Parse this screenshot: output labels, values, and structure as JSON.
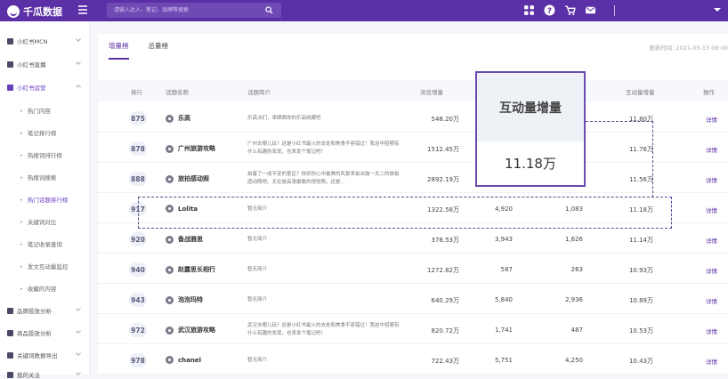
{
  "app": {
    "logo_text": "千瓜数据"
  },
  "search": {
    "placeholder": "请输入达人、笔记、品牌等搜索"
  },
  "sidebar": {
    "sections": [
      {
        "label": "小红书MCN"
      },
      {
        "label": "小红书直播"
      },
      {
        "label": "小红书运营"
      }
    ],
    "subitems": [
      {
        "label": "热门内容"
      },
      {
        "label": "笔记排行榜"
      },
      {
        "label": "热搜词排行榜"
      },
      {
        "label": "热搜词搜索"
      },
      {
        "label": "热门话题排行榜"
      },
      {
        "label": "关键词对比"
      },
      {
        "label": "笔记收录查询"
      },
      {
        "label": "发文互动量监控"
      },
      {
        "label": "收藏的内容"
      }
    ],
    "bottom": [
      {
        "label": "品牌投放分析"
      },
      {
        "label": "商品投放分析"
      },
      {
        "label": "关键词数据导出"
      },
      {
        "label": "我的关注"
      }
    ]
  },
  "tabs": [
    {
      "label": "增量榜"
    },
    {
      "label": "总量榜"
    }
  ],
  "update_label": "更新时间:",
  "update_time": "2021-05-13 08:00",
  "table": {
    "headers": {
      "rank": "排行",
      "topic": "话题名称",
      "intro": "话题简介",
      "views": "浏览增量",
      "inc": "互动量增量",
      "op": "操作"
    },
    "rows": [
      {
        "rank": "875",
        "topic": "乐高",
        "intro": "乐高派们，来晒晒你的乐高收藏吧",
        "views": "548.20万",
        "a": "",
        "b": "",
        "inc": "11.80万",
        "op": "详情"
      },
      {
        "rank": "878",
        "topic": "广州旅游攻略",
        "intro": "广州去哪儿玩？这是小红书最火的去处和美食不容错过！我这中招哪有什么有趣的发现，也来发个笔记吧！",
        "views": "1512.45万",
        "a": "",
        "b": "",
        "inc": "11.76万",
        "op": "详情"
      },
      {
        "rank": "888",
        "topic": "旅拍感动照",
        "intro": "拍着了一成不变的景区？快到你心中最美的风景来拍出独一无二的旅拍感动照吧。无论是高清摄像的视觉照，还是...",
        "views": "2892.19万",
        "a": "",
        "b": "",
        "inc": "11.56万",
        "op": "详情"
      },
      {
        "rank": "917",
        "topic": "Lolita",
        "intro": "暂无简介",
        "views": "1322.58万",
        "a": "4,920",
        "b": "1,083",
        "inc": "11.18万",
        "op": "详情"
      },
      {
        "rank": "920",
        "topic": "备战雅思",
        "intro": "暂无简介",
        "views": "378.53万",
        "a": "3,943",
        "b": "1,626",
        "inc": "11.14万",
        "op": "详情"
      },
      {
        "rank": "940",
        "topic": "赵露思长相行",
        "intro": "暂无简介",
        "views": "1272.82万",
        "a": "587",
        "b": "263",
        "inc": "10.93万",
        "op": "详情"
      },
      {
        "rank": "943",
        "topic": "泡泡玛特",
        "intro": "暂无简介",
        "views": "640.29万",
        "a": "5,840",
        "b": "2,936",
        "inc": "10.89万",
        "op": "详情"
      },
      {
        "rank": "972",
        "topic": "武汉旅游攻略",
        "intro": "武汉去哪儿玩？这是小红书最火的去处和美食不容错过！我这中招哪有什么有趣的发现，也来发个笔记吧！",
        "views": "820.72万",
        "a": "1,741",
        "b": "487",
        "inc": "10.53万",
        "op": "详情"
      },
      {
        "rank": "978",
        "topic": "chanel",
        "intro": "暂无简介",
        "views": "722.43万",
        "a": "5,751",
        "b": "4,250",
        "inc": "10.43万",
        "op": "详情"
      }
    ]
  },
  "callout": {
    "title": "互动量增量",
    "value": "11.18万"
  },
  "colors": {
    "brand": "#5b2fa6",
    "accent": "#6a3fbf"
  }
}
